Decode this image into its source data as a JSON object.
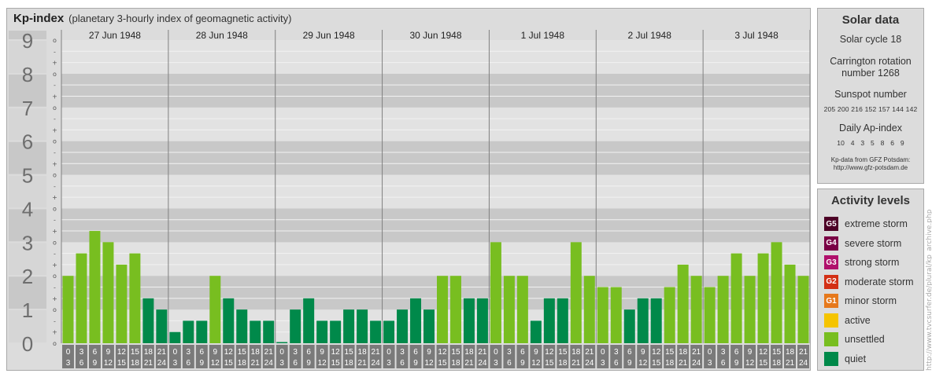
{
  "header": {
    "title": "Kp-index",
    "subtitle": "(planetary 3-hourly index of geomagnetic activity)"
  },
  "chart_data": {
    "type": "bar",
    "y_major_labels": [
      "0",
      "1",
      "2",
      "3",
      "4",
      "5",
      "6",
      "7",
      "8",
      "9"
    ],
    "y_minor_labels": [
      "o",
      "+",
      "-",
      "o",
      "+",
      "-",
      "o",
      "+",
      "-",
      "o",
      "+",
      "-",
      "o",
      "+",
      "-",
      "o",
      "+",
      "-",
      "o",
      "+",
      "-",
      "o",
      "+",
      "-",
      "o",
      "+",
      "-",
      "o"
    ],
    "ylim": [
      0,
      9
    ],
    "days": [
      "27 Jun 1948",
      "28 Jun 1948",
      "29 Jun 1948",
      "30 Jun 1948",
      "1 Jul 1948",
      "2 Jul 1948",
      "3 Jul 1948"
    ],
    "hour_labels_top": [
      "0",
      "3",
      "6",
      "9",
      "12",
      "15",
      "18",
      "21"
    ],
    "hour_labels_bottom": [
      "3",
      "6",
      "9",
      "12",
      "15",
      "18",
      "21",
      "24"
    ],
    "values": [
      2.0,
      2.667,
      3.333,
      3.0,
      2.333,
      2.667,
      1.333,
      1.0,
      0.333,
      0.667,
      0.667,
      2.0,
      1.333,
      1.0,
      0.667,
      0.667,
      0.0,
      1.0,
      1.333,
      0.667,
      0.667,
      1.0,
      1.0,
      0.667,
      0.667,
      1.0,
      1.333,
      1.0,
      2.0,
      2.0,
      1.333,
      1.333,
      3.0,
      2.0,
      2.0,
      0.667,
      1.333,
      1.333,
      3.0,
      2.0,
      1.667,
      1.667,
      1.0,
      1.333,
      1.333,
      1.667,
      2.333,
      2.0,
      1.667,
      2.0,
      2.667,
      2.0,
      2.667,
      3.0,
      2.333,
      2.0
    ],
    "colors": {
      "quiet": "#00894a",
      "unsettled": "#78be20",
      "band_dark": "#c8c8c8",
      "band_light": "#e2e2e2",
      "hour_box": "#7a7a7a",
      "y_label": "#6e6e6e"
    }
  },
  "solar": {
    "title": "Solar data",
    "cycle": "Solar cycle 18",
    "carrington_1": "Carrington rotation",
    "carrington_2": "number 1268",
    "sunspot_title": "Sunspot number",
    "sunspot_values": "205 200 216 152 157 144 142",
    "ap_title": "Daily Ap-index",
    "ap_values": "10   4   3   5   8   6   9",
    "source_1": "Kp-data from GFZ Potsdam:",
    "source_2": "http://www.gfz-potsdam.de"
  },
  "activity": {
    "title": "Activity levels",
    "items": [
      {
        "code": "G5",
        "label": "extreme storm",
        "color": "#4d0026"
      },
      {
        "code": "G4",
        "label": "severe storm",
        "color": "#7a0045"
      },
      {
        "code": "G3",
        "label": "strong storm",
        "color": "#b0106b"
      },
      {
        "code": "G2",
        "label": "moderate storm",
        "color": "#d33015"
      },
      {
        "code": "G1",
        "label": "minor storm",
        "color": "#e6791c"
      },
      {
        "code": "",
        "label": "active",
        "color": "#f5c400"
      },
      {
        "code": "",
        "label": "unsettled",
        "color": "#78be20"
      },
      {
        "code": "",
        "label": "quiet",
        "color": "#00894a"
      }
    ]
  },
  "credit": "http://www.tvcsurfer.de/plural/kp_archive.php"
}
